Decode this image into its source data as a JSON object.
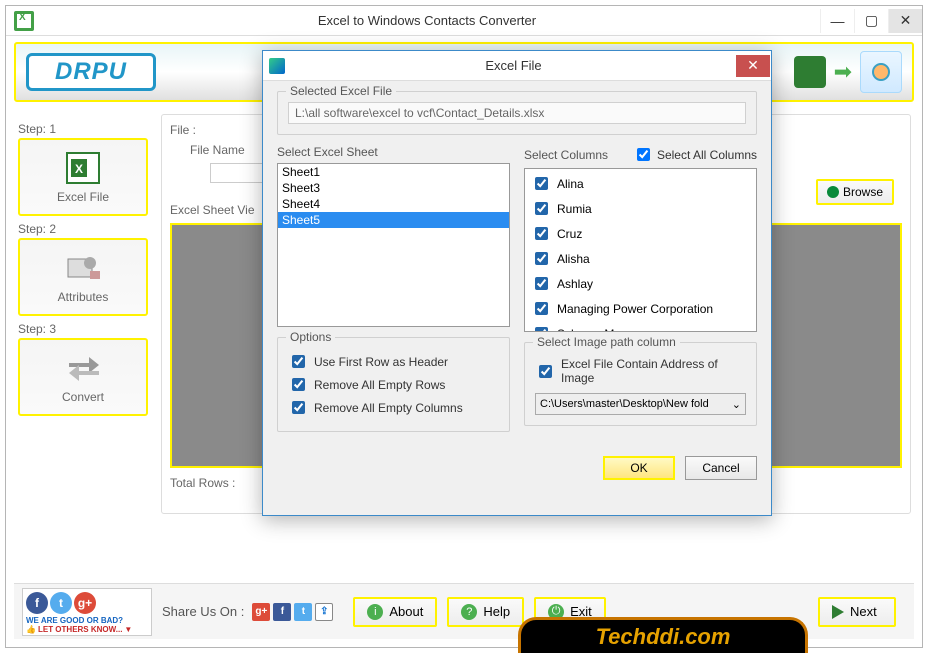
{
  "window": {
    "title": "Excel to Windows Contacts Converter",
    "logo": "DRPU"
  },
  "sidebar": {
    "steps": [
      {
        "label": "Step: 1",
        "name": "Excel File"
      },
      {
        "label": "Step: 2",
        "name": "Attributes"
      },
      {
        "label": "Step: 3",
        "name": "Convert"
      }
    ]
  },
  "main": {
    "file_label": "File :",
    "file_name_label": "File Name",
    "sheet_view_label": "Excel Sheet Vie",
    "total_rows_label": "Total Rows :",
    "browse": "Browse"
  },
  "bottom": {
    "share_label": "Share Us On :",
    "good_bad": "WE ARE GOOD OR BAD?",
    "let_others": "LET OTHERS KNOW...",
    "about": "About",
    "help": "Help",
    "exit": "Exit",
    "next": "Next"
  },
  "dialog": {
    "title": "Excel File",
    "selected_label": "Selected Excel File",
    "selected_path": "L:\\all software\\excel to vcf\\Contact_Details.xlsx",
    "sheet_label": "Select Excel Sheet",
    "sheets": [
      "Sheet1",
      "Sheet3",
      "Sheet4",
      "Sheet5"
    ],
    "selected_sheet": "Sheet5",
    "columns_label": "Select Columns",
    "select_all_label": "Select All Columns",
    "columns": [
      "Alina",
      "Rumia",
      "Cruz",
      "Alisha",
      "Ashlay",
      "Managing Power Corporation",
      "Scheme Manager"
    ],
    "options_label": "Options",
    "opt1": "Use First Row as Header",
    "opt2": "Remove All Empty Rows",
    "opt3": "Remove All Empty Columns",
    "img_label": "Select Image path column",
    "img_chk": "Excel File Contain Address of Image",
    "img_path": "C:\\Users\\master\\Desktop\\New fold",
    "ok": "OK",
    "cancel": "Cancel"
  },
  "techddi": "Techddi.com"
}
